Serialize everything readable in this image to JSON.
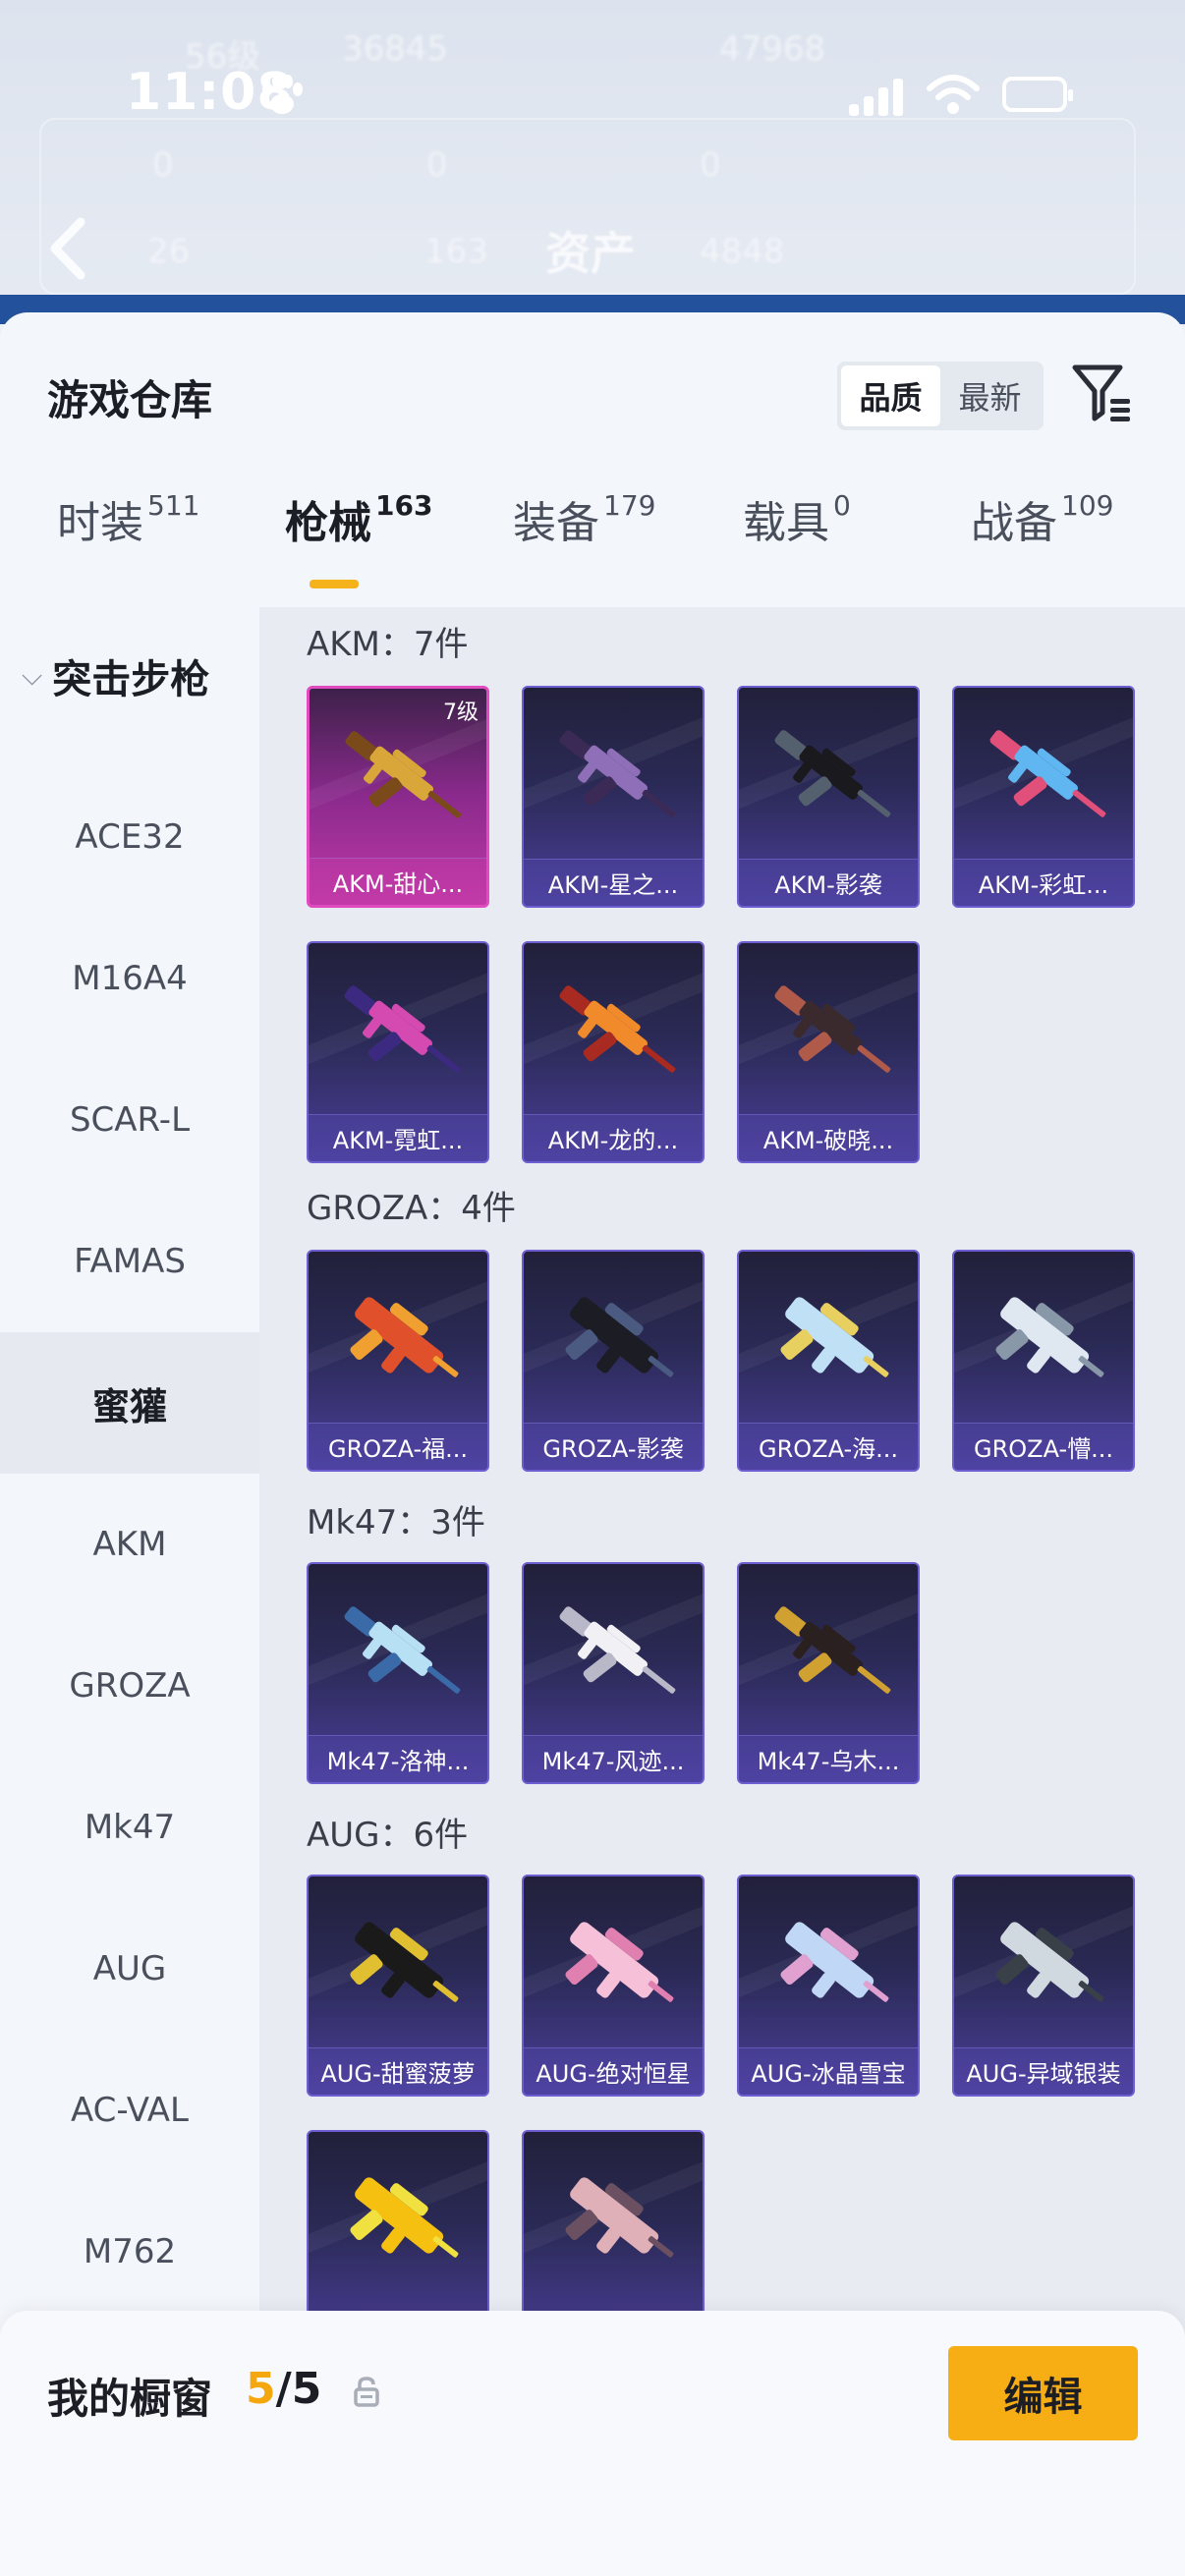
{
  "status_bar": {
    "time": "11:08"
  },
  "background": {
    "ghost_texts": [
      "56级",
      "36845",
      "47968",
      "0",
      "0",
      "0",
      "26",
      "163",
      "4848"
    ],
    "title": "资产"
  },
  "sheet": {
    "title": "游戏仓库",
    "sort_options": [
      "品质",
      "最新"
    ],
    "active_sort": "品质",
    "tabs": [
      {
        "label": "时装",
        "count": "511"
      },
      {
        "label": "枪械",
        "count": "163"
      },
      {
        "label": "装备",
        "count": "179"
      },
      {
        "label": "载具",
        "count": "0"
      },
      {
        "label": "战备",
        "count": "109"
      }
    ],
    "active_tab": "枪械"
  },
  "sidebar": {
    "category": "突击步枪",
    "items": [
      "ACE32",
      "M16A4",
      "SCAR-L",
      "FAMAS",
      "蜜獾",
      "AKM",
      "GROZA",
      "Mk47",
      "AUG",
      "AC-VAL",
      "M762"
    ],
    "active_item": "蜜獾"
  },
  "groups": [
    {
      "title": "AKM：7件",
      "items": [
        {
          "name": "AKM-甜心...",
          "level": "7级",
          "rarity": "pink",
          "colors": [
            "#d9a63a",
            "#7a4a1a"
          ]
        },
        {
          "name": "AKM-星之...",
          "rarity": "purple",
          "colors": [
            "#8e6fb8",
            "#3a2a55"
          ]
        },
        {
          "name": "AKM-影袭",
          "rarity": "purple",
          "colors": [
            "#1a1a1e",
            "#55606e"
          ]
        },
        {
          "name": "AKM-彩虹...",
          "rarity": "purple",
          "colors": [
            "#5fb6f0",
            "#e0507a"
          ]
        },
        {
          "name": "AKM-霓虹...",
          "rarity": "purple",
          "colors": [
            "#d44ab0",
            "#3b2a80"
          ]
        },
        {
          "name": "AKM-龙的...",
          "rarity": "purple",
          "colors": [
            "#f08a2a",
            "#a82a20"
          ]
        },
        {
          "name": "AKM-破晓...",
          "rarity": "purple",
          "colors": [
            "#3a2a2e",
            "#b05a4a"
          ]
        }
      ]
    },
    {
      "title": "GROZA：4件",
      "items": [
        {
          "name": "GROZA-福...",
          "rarity": "purple",
          "colors": [
            "#e0502a",
            "#f0a030"
          ]
        },
        {
          "name": "GROZA-影袭",
          "rarity": "purple",
          "colors": [
            "#1c1c24",
            "#4a5a80"
          ]
        },
        {
          "name": "GROZA-海...",
          "rarity": "purple",
          "colors": [
            "#bfe0f5",
            "#e8d060"
          ]
        },
        {
          "name": "GROZA-懵...",
          "rarity": "purple",
          "colors": [
            "#dfe8f0",
            "#8898a8"
          ]
        }
      ]
    },
    {
      "title": "Mk47：3件",
      "items": [
        {
          "name": "Mk47-洛神...",
          "rarity": "purple",
          "colors": [
            "#b8e0f5",
            "#3a6aa8"
          ]
        },
        {
          "name": "Mk47-风迹...",
          "rarity": "purple",
          "colors": [
            "#f0f0f5",
            "#b8b8c8"
          ]
        },
        {
          "name": "Mk47-乌木...",
          "rarity": "purple",
          "colors": [
            "#2a2020",
            "#d0a030"
          ]
        }
      ]
    },
    {
      "title": "AUG：6件",
      "items": [
        {
          "name": "AUG-甜蜜菠萝",
          "rarity": "purple",
          "colors": [
            "#1a1a1a",
            "#e0c030"
          ]
        },
        {
          "name": "AUG-绝对恒星",
          "rarity": "purple",
          "colors": [
            "#f5c0d8",
            "#e080b0"
          ]
        },
        {
          "name": "AUG-冰晶雪宝",
          "rarity": "purple",
          "colors": [
            "#c0d8f5",
            "#e0a0d0"
          ]
        },
        {
          "name": "AUG-异域银装",
          "rarity": "purple",
          "colors": [
            "#d0d8e0",
            "#3a4048"
          ]
        },
        {
          "name": "",
          "rarity": "purple",
          "colors": [
            "#f5c010",
            "#f0e040"
          ]
        },
        {
          "name": "",
          "rarity": "purple",
          "colors": [
            "#e0b0b8",
            "#6a5060"
          ]
        }
      ]
    }
  ],
  "bottom_bar": {
    "title": "我的橱窗",
    "current": "5",
    "total": "/5",
    "edit_label": "编辑"
  },
  "colors": {
    "accent": "#f5a70f",
    "card_border": "#6d5fd1",
    "pink_border": "#e04cc0"
  }
}
